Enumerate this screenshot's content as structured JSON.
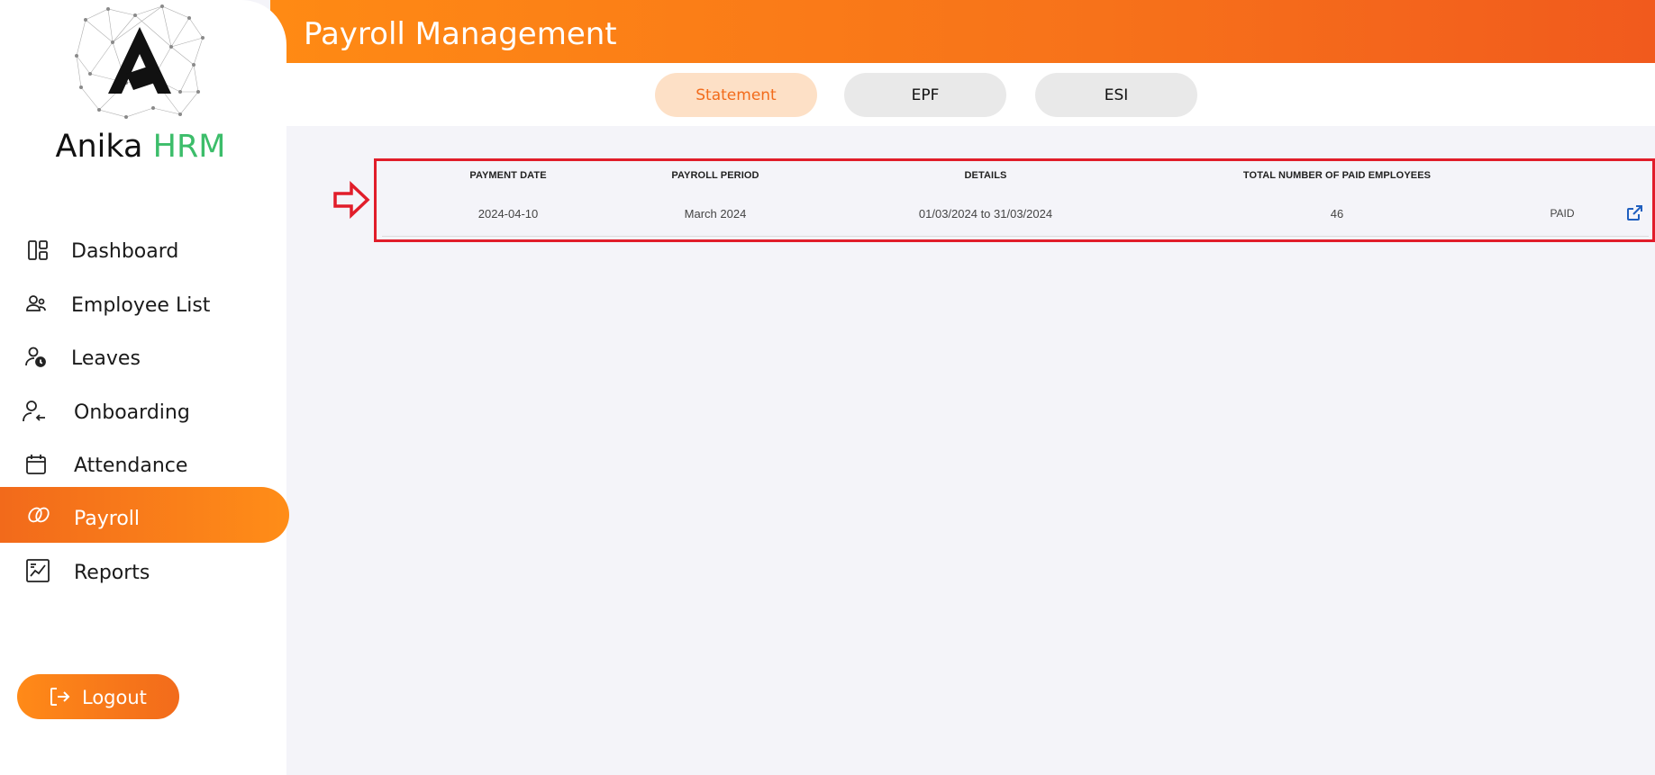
{
  "app": {
    "brand_name": "Anika",
    "brand_accent": "HRM",
    "accent_color": "#f26b1b",
    "brand_green": "#3cbd6a"
  },
  "sidebar": {
    "items": [
      {
        "label": "Dashboard",
        "icon": "dashboard-icon",
        "active": false
      },
      {
        "label": "Employee List",
        "icon": "users-icon",
        "active": false
      },
      {
        "label": "Leaves",
        "icon": "user-clock-icon",
        "active": false
      },
      {
        "label": "Onboarding",
        "icon": "user-arrow-icon",
        "active": false
      },
      {
        "label": "Attendance",
        "icon": "calendar-icon",
        "active": false
      },
      {
        "label": "Payroll",
        "icon": "payroll-icon",
        "active": true
      },
      {
        "label": "Reports",
        "icon": "chart-icon",
        "active": false
      }
    ],
    "logout_label": "Logout"
  },
  "header": {
    "title": "Payroll Management"
  },
  "tabs": [
    {
      "label": "Statement",
      "active": true
    },
    {
      "label": "EPF",
      "active": false
    },
    {
      "label": "ESI",
      "active": false
    }
  ],
  "table": {
    "headers": [
      "PAYMENT DATE",
      "PAYROLL PERIOD",
      "DETAILS",
      "TOTAL NUMBER OF PAID EMPLOYEES"
    ],
    "rows": [
      {
        "payment_date": "2024-04-10",
        "payroll_period": "March 2024",
        "details": "01/03/2024 to 31/03/2024",
        "paid_employees": "46",
        "status": "PAID",
        "action_icon": "external-link-icon"
      }
    ]
  },
  "annotation": {
    "highlight_color": "#e11d2a",
    "arrow_icon": "right-arrow-icon"
  }
}
